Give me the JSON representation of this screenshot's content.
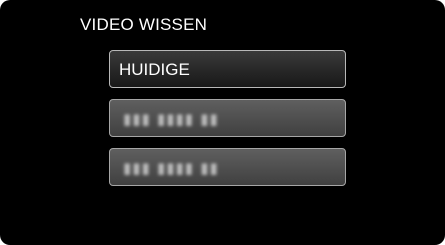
{
  "screen": {
    "title": "VIDEO WISSEN"
  },
  "menu": {
    "items": [
      {
        "label": "HUIDIGE",
        "state": "selected"
      },
      {
        "label": "▮▮▮ ▮▮▮▮ ▮▮",
        "state": "blurred"
      },
      {
        "label": "▮▮▮ ▮▮▮▮ ▮▮",
        "state": "blurred"
      }
    ]
  },
  "colors": {
    "background": "#000000",
    "text": "#ffffff",
    "selected_button": "#272727",
    "unselected_button": "#4e4e4e",
    "button_border": "#9a9a9a"
  }
}
